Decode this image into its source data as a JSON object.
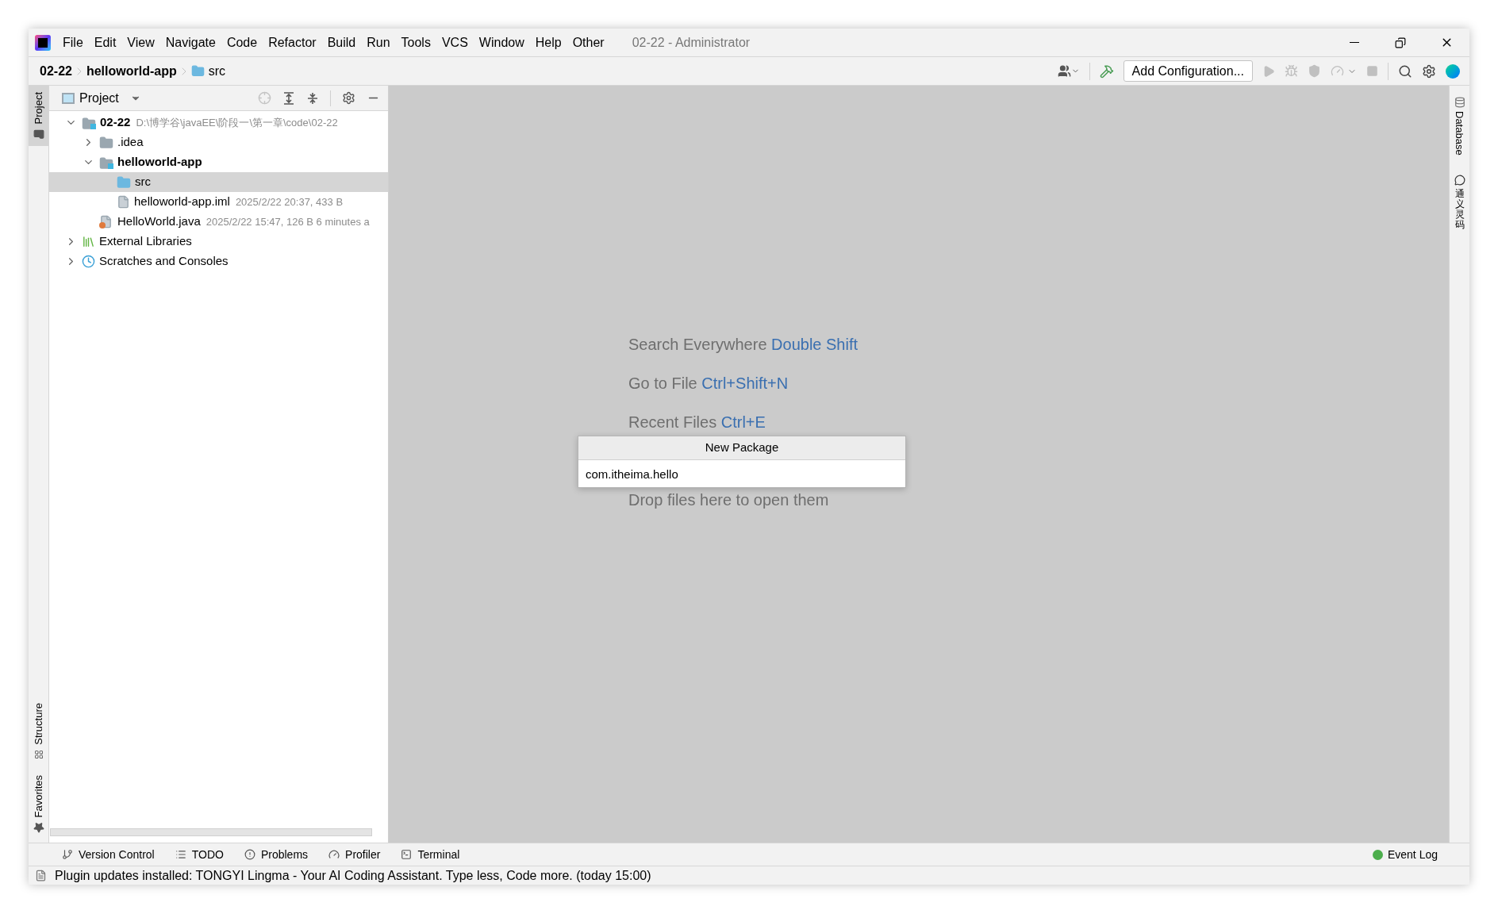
{
  "window": {
    "title": "02-22 - Administrator"
  },
  "menu": [
    "File",
    "Edit",
    "View",
    "Navigate",
    "Code",
    "Refactor",
    "Build",
    "Run",
    "Tools",
    "VCS",
    "Window",
    "Help",
    "Other"
  ],
  "breadcrumbs": [
    {
      "label": "02-22",
      "kind": "module"
    },
    {
      "label": "helloworld-app",
      "kind": "module"
    },
    {
      "label": "src",
      "kind": "folder"
    }
  ],
  "toolbar": {
    "run_configuration": "Add Configuration..."
  },
  "left_tool_tabs": [
    {
      "label": "Project",
      "selected": true,
      "kind": "project"
    }
  ],
  "left_bottom_tabs": [
    {
      "label": "Structure",
      "kind": "structure"
    },
    {
      "label": "Favorites",
      "kind": "favorites"
    }
  ],
  "right_tool_tabs": [
    {
      "label": "Database",
      "kind": "database"
    },
    {
      "label": "通义灵码",
      "kind": "lingma"
    }
  ],
  "project_panel": {
    "title": "Project",
    "tree": [
      {
        "label": "02-22",
        "bold": true,
        "meta": "D:\\博学谷\\javaEE\\阶段一\\第一章\\code\\02-22",
        "kind": "module",
        "expanded": true,
        "selected": false,
        "children": [
          {
            "label": ".idea",
            "bold": false,
            "kind": "folder",
            "expanded": false,
            "selected": false
          },
          {
            "label": "helloworld-app",
            "bold": true,
            "kind": "module",
            "expanded": true,
            "selected": false,
            "children": [
              {
                "label": "src",
                "bold": false,
                "kind": "source",
                "selected": true
              },
              {
                "label": "helloworld-app.iml",
                "bold": false,
                "meta": "2025/2/22 20:37, 433 B",
                "kind": "iml",
                "selected": false
              }
            ]
          },
          {
            "label": "HelloWorld.java",
            "bold": false,
            "meta": "2025/2/22 15:47, 126 B 6 minutes a",
            "kind": "java",
            "selected": false
          }
        ]
      },
      {
        "label": "External Libraries",
        "bold": false,
        "kind": "libraries",
        "expanded": false,
        "selected": false
      },
      {
        "label": "Scratches and Consoles",
        "bold": false,
        "kind": "scratches",
        "expanded": false,
        "selected": false
      }
    ]
  },
  "editor_hints": [
    {
      "label": "Search Everywhere",
      "shortcut": "Double Shift",
      "kind": "shortcut"
    },
    {
      "label": "Go to File",
      "shortcut": "Ctrl+Shift+N",
      "kind": "shortcut"
    },
    {
      "label": "Recent Files",
      "shortcut": "Ctrl+E",
      "kind": "shortcut"
    },
    {
      "label": "Drop files here to open them",
      "kind": "plain"
    }
  ],
  "new_package_popup": {
    "title": "New Package",
    "value": "com.itheima.hello"
  },
  "bottom_tool_tabs": [
    {
      "label": "Version Control",
      "kind": "vcs"
    },
    {
      "label": "TODO",
      "kind": "todo"
    },
    {
      "label": "Problems",
      "kind": "problems"
    },
    {
      "label": "Profiler",
      "kind": "profiler"
    },
    {
      "label": "Terminal",
      "kind": "terminal"
    }
  ],
  "event_log": {
    "label": "Event Log"
  },
  "status_bar": {
    "message": "Plugin updates installed: TONGYI Lingma - Your AI Coding Assistant. Type less, Code more. (today 15:00)"
  }
}
